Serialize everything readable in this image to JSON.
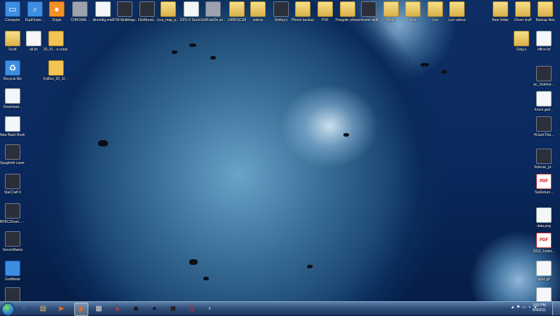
{
  "desktop": {
    "icons_top_row": [
      {
        "label": "Computer",
        "icon": "computer-icon",
        "name": "computer"
      },
      {
        "label": "DupFinder....",
        "icon": "magnifier-icon",
        "name": "dupfinder"
      },
      {
        "label": "Origin",
        "icon": "origin-icon",
        "name": "origin"
      },
      {
        "label": "CHROMA...",
        "icon": "window-icon",
        "name": "chroma"
      },
      {
        "label": "directdig.mist",
        "icon": "document-icon",
        "name": "directdig"
      },
      {
        "label": "STM Multilinge...",
        "icon": "app-icon",
        "name": "stm"
      },
      {
        "label": "FileMount...",
        "icon": "app-icon",
        "name": "filemount"
      },
      {
        "label": "icca_map_p...",
        "icon": "folder-icon",
        "name": "icca-map"
      },
      {
        "label": "GPU-Z Servi...",
        "icon": "document-icon",
        "name": "gpu-z"
      },
      {
        "label": "SoftFastOn.uri - Shortcut",
        "icon": "shortcut-icon",
        "name": "softfaston"
      },
      {
        "label": "LMBOSCIM",
        "icon": "folder-icon",
        "name": "lmboscim"
      },
      {
        "label": "videos",
        "icon": "folder-icon",
        "name": "videos"
      },
      {
        "label": "Smiley's",
        "icon": "app-icon",
        "name": "smileys"
      },
      {
        "label": "Phone backup",
        "icon": "folder-icon",
        "name": "phone-backup"
      },
      {
        "label": "PDF",
        "icon": "folder-icon",
        "name": "pdf-folder"
      },
      {
        "label": "Pangolin shows",
        "icon": "folder-icon",
        "name": "pangolin"
      },
      {
        "label": "chrome stuff",
        "icon": "app-icon",
        "name": "chrome-stuff"
      },
      {
        "label": "Ohm...",
        "icon": "folder-icon",
        "name": "ohm"
      },
      {
        "label": "test",
        "icon": "folder-icon",
        "name": "test"
      },
      {
        "label": "Levi",
        "icon": "folder-icon",
        "name": "levi"
      },
      {
        "label": "Levi videos",
        "icon": "folder-icon",
        "name": "levi-videos"
      },
      {
        "label": "New folder",
        "icon": "folder-icon",
        "name": "new-folder"
      },
      {
        "label": "Driver stuff",
        "icon": "folder-icon",
        "name": "driver-stuff"
      },
      {
        "label": "Backup files",
        "icon": "folder-icon",
        "name": "backup-files"
      }
    ],
    "icons_left": [
      {
        "label": "Scott",
        "icon": "folder-icon",
        "name": "scott"
      },
      {
        "label": "all.txt",
        "icon": "document-icon",
        "name": "all-txt"
      },
      {
        "label": "20_01 - a coast.city.jp...",
        "icon": "archive-icon",
        "name": "coast-city"
      },
      {
        "label": "Recycle Bin",
        "icon": "recycle-bin-icon",
        "name": "recycle-bin"
      },
      {
        "label": "Kollins_20_11 - a coast a...",
        "icon": "archive-icon",
        "name": "kollins"
      },
      {
        "label": "Download...",
        "icon": "document-icon",
        "name": "download"
      },
      {
        "label": "New Bank Book.xls",
        "icon": "document-icon",
        "name": "new-bank-book"
      },
      {
        "label": "Spaghetti Laser Show",
        "icon": "app-icon",
        "name": "spaghetti"
      },
      {
        "label": "StarCraft II",
        "icon": "app-icon",
        "name": "starcraft"
      },
      {
        "label": "BFBC2Gam... - Shortcut",
        "icon": "app-icon",
        "name": "bfbc2"
      },
      {
        "label": "ServerMania",
        "icon": "app-icon",
        "name": "servermania"
      },
      {
        "label": "GodMode",
        "icon": "control-panel-icon",
        "name": "godmode"
      },
      {
        "label": "",
        "icon": "app-icon",
        "name": "unnamed-app"
      }
    ],
    "icons_right": [
      {
        "label": "Dwg.s",
        "icon": "folder-icon",
        "name": "dwgs"
      },
      {
        "label": "office.txt",
        "icon": "document-icon",
        "name": "office-txt"
      },
      {
        "label": "pc_Solenar...",
        "icon": "app-icon",
        "name": "pc-solenar"
      },
      {
        "label": "forum.ged...",
        "icon": "document-icon",
        "name": "forum-ged"
      },
      {
        "label": "HiJackThis...",
        "icon": "app-icon",
        "name": "hijackthis"
      },
      {
        "label": "Solenar_pl...",
        "icon": "app-icon",
        "name": "solenar-pl"
      },
      {
        "label": "TaxReturn...",
        "icon": "pdf-icon",
        "name": "taxreturn"
      },
      {
        "label": "data.png",
        "icon": "image-icon",
        "name": "data-png"
      },
      {
        "label": "2010_Feder...",
        "icon": "pdf-icon",
        "name": "federal"
      },
      {
        "label": "apoc.gif",
        "icon": "image-icon",
        "name": "apoc-gif"
      },
      {
        "label": "",
        "icon": "document-icon",
        "name": "blank-doc"
      }
    ]
  },
  "taskbar": {
    "apps": [
      {
        "name": "internet-explorer",
        "glyph": "e"
      },
      {
        "name": "windows-explorer",
        "glyph": "▤"
      },
      {
        "name": "media-player",
        "glyph": "▶"
      },
      {
        "name": "firefox",
        "glyph": "◉"
      },
      {
        "name": "taskbar-app-5",
        "glyph": "▦"
      },
      {
        "name": "taskbar-app-6",
        "glyph": "▲"
      },
      {
        "name": "taskbar-app-7",
        "glyph": "◆"
      },
      {
        "name": "taskbar-app-8",
        "glyph": "●"
      },
      {
        "name": "taskbar-app-9",
        "glyph": "◼"
      },
      {
        "name": "taskbar-app-10",
        "glyph": "Q"
      },
      {
        "name": "taskbar-app-11",
        "glyph": "◐"
      }
    ],
    "clock_time": "3:52 PM",
    "clock_date": "8/4/2011"
  }
}
